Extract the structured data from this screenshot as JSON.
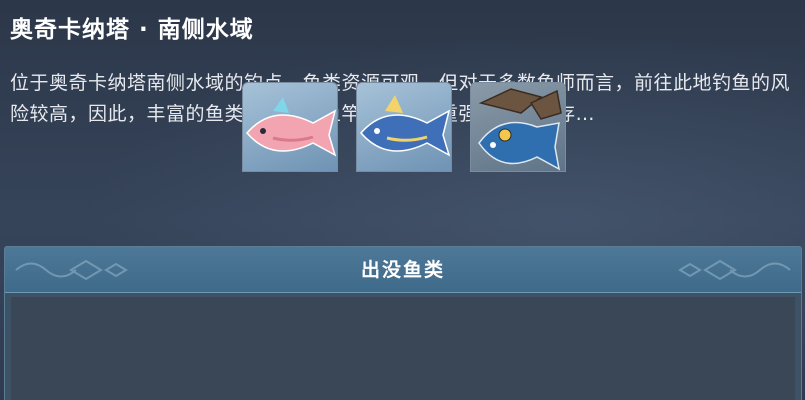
{
  "location": {
    "title": "奥奇卡纳塔 · 南侧水域",
    "description": "位于奥奇卡纳塔南侧水域的钓点，鱼类资源可观，但对于多数鱼师而言，前往此地钓鱼的风险较高，因此，丰富的鱼类资源正为鱼竿与剑的双重强者长久留存…"
  },
  "fish_panel": {
    "header": "出没鱼类",
    "fish": [
      {
        "icon": "pink-fish-icon",
        "color": "#f2a5b0"
      },
      {
        "icon": "blue-fish-icon",
        "color": "#3f6fb8"
      },
      {
        "icon": "armored-fish-icon",
        "color": "#2f6fb0"
      }
    ]
  },
  "colors": {
    "background": "#2f3b4e",
    "panel_header": "#4d7897",
    "text": "#ffffff"
  }
}
